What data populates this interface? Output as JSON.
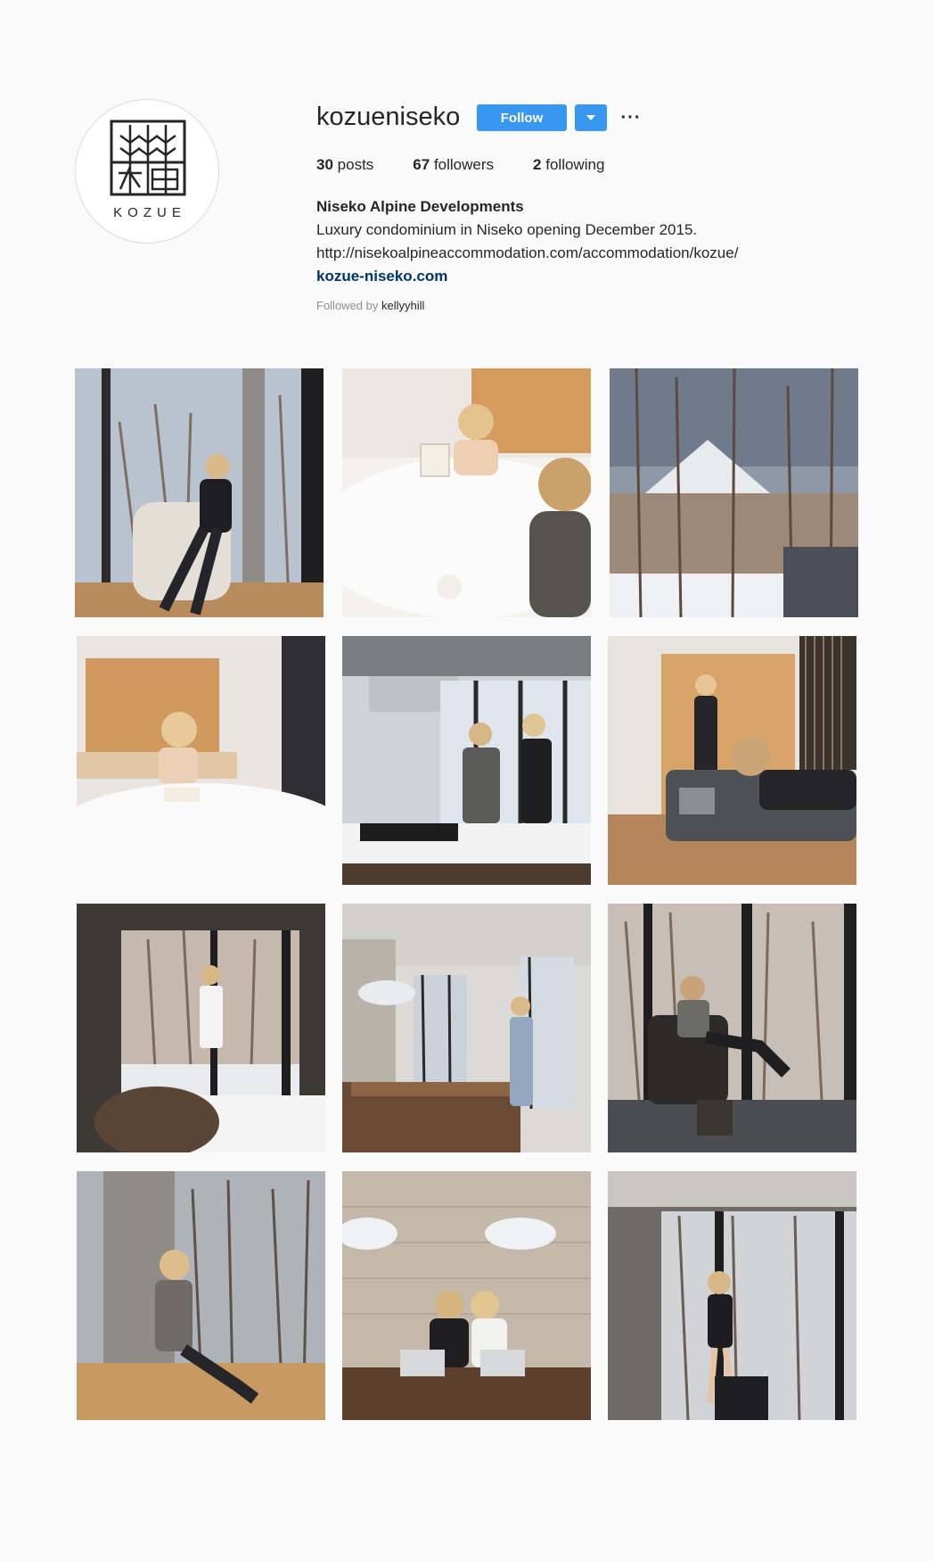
{
  "profile": {
    "username": "kozueniseko",
    "avatar_logo_text": "KOZUE",
    "follow_label": "Follow",
    "dropdown_icon": "caret-down-icon",
    "more_label": "···",
    "stats": {
      "posts_count": "30",
      "posts_label": "posts",
      "followers_count": "67",
      "followers_label": "followers",
      "following_count": "2",
      "following_label": "following"
    },
    "bio": {
      "name": "Niseko Alpine Developments",
      "line1": "Luxury condominium in Niseko opening December 2015.",
      "line2": "http://nisekoalpineaccommodation.com/accommodation/kozue/",
      "website": "kozue-niseko.com"
    },
    "followed_by_label": "Followed by",
    "followed_by_user": "kellyyhill"
  },
  "colors": {
    "accent": "#3897f0",
    "link": "#003569",
    "background": "#fafafa",
    "muted": "#8e8e8e"
  },
  "posts": [
    {
      "scene": "woman-in-armchair-by-window"
    },
    {
      "scene": "woman-reading-in-bed"
    },
    {
      "scene": "snowy-mountain-through-trees"
    },
    {
      "scene": "woman-laughing-in-bed"
    },
    {
      "scene": "couple-in-kitchen"
    },
    {
      "scene": "woman-in-hallway-with-sofa"
    },
    {
      "scene": "woman-by-window-in-towel"
    },
    {
      "scene": "woman-in-dining-room"
    },
    {
      "scene": "man-in-chair-by-window"
    },
    {
      "scene": "woman-sitting-on-floor"
    },
    {
      "scene": "two-women-with-laptops"
    },
    {
      "scene": "woman-by-window-in-swimwear"
    }
  ]
}
